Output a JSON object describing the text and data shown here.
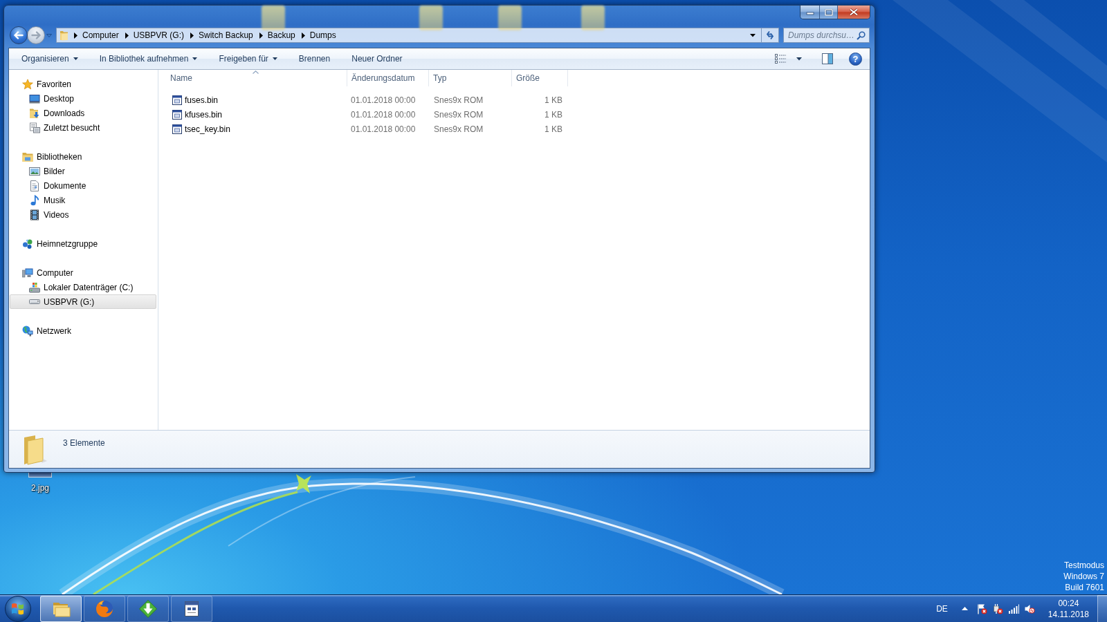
{
  "window": {
    "navigation": {
      "back": {
        "disabled": false
      },
      "forward": {
        "disabled": true
      }
    },
    "address_bar": {
      "breadcrumbs": [
        "Computer",
        "USBPVR (G:)",
        "Switch Backup",
        "Backup",
        "Dumps"
      ]
    },
    "search": {
      "placeholder": "Dumps durchsu…"
    },
    "toolbar": {
      "items": [
        {
          "label": "Organisieren",
          "dropdown": true
        },
        {
          "label": "In Bibliothek aufnehmen",
          "dropdown": true
        },
        {
          "label": "Freigeben für",
          "dropdown": true
        },
        {
          "label": "Brennen",
          "dropdown": false
        },
        {
          "label": "Neuer Ordner",
          "dropdown": false
        }
      ],
      "help_label": "?"
    },
    "sidebar": {
      "groups": [
        {
          "label": "Favoriten",
          "kind": "star",
          "selected": false,
          "children": [
            {
              "label": "Desktop",
              "kind": "desktop",
              "selected": false
            },
            {
              "label": "Downloads",
              "kind": "downloads",
              "selected": false
            },
            {
              "label": "Zuletzt besucht",
              "kind": "recent",
              "selected": false
            }
          ]
        },
        {
          "label": "Bibliotheken",
          "kind": "libraries",
          "selected": false,
          "children": [
            {
              "label": "Bilder",
              "kind": "pictures",
              "selected": false
            },
            {
              "label": "Dokumente",
              "kind": "documents",
              "selected": false
            },
            {
              "label": "Musik",
              "kind": "music",
              "selected": false
            },
            {
              "label": "Videos",
              "kind": "videos",
              "selected": false
            }
          ]
        },
        {
          "label": "Heimnetzgruppe",
          "kind": "homegroup",
          "selected": false
        },
        {
          "label": "Computer",
          "kind": "computer",
          "selected": false,
          "children": [
            {
              "label": "Lokaler Datenträger (C:)",
              "kind": "system_drive",
              "selected": false
            },
            {
              "label": "USBPVR (G:)",
              "kind": "usb_drive",
              "selected": true
            }
          ]
        },
        {
          "label": "Netzwerk",
          "kind": "network",
          "selected": false
        }
      ]
    },
    "file_list": {
      "columns": [
        {
          "label": "Name",
          "sorted": true
        },
        {
          "label": "Änderungsdatum",
          "sorted": false
        },
        {
          "label": "Typ",
          "sorted": false
        },
        {
          "label": "Größe",
          "sorted": false
        }
      ],
      "rows": [
        {
          "name": "fuses.bin",
          "modified": "01.01.2018 00:00",
          "type": "Snes9x ROM",
          "size": "1 KB",
          "selected": false
        },
        {
          "name": "kfuses.bin",
          "modified": "01.01.2018 00:00",
          "type": "Snes9x ROM",
          "size": "1 KB",
          "selected": false
        },
        {
          "name": "tsec_key.bin",
          "modified": "01.01.2018 00:00",
          "type": "Snes9x ROM",
          "size": "1 KB",
          "selected": false
        }
      ]
    },
    "details_pane": {
      "item_count": "3 Elemente"
    }
  },
  "desktop": {
    "icons": [
      {
        "label": "2.jpg"
      }
    ],
    "notice_lines": [
      "Testmodus",
      "Windows 7",
      "Build 7601"
    ]
  },
  "taskbar": {
    "apps": [
      {
        "kind": "explorer",
        "active": true
      },
      {
        "kind": "browser",
        "active": false
      },
      {
        "kind": "downloader",
        "active": false
      },
      {
        "kind": "editor",
        "active": false
      }
    ],
    "language": "DE",
    "time": "00:24",
    "date": "14.11.2018"
  }
}
